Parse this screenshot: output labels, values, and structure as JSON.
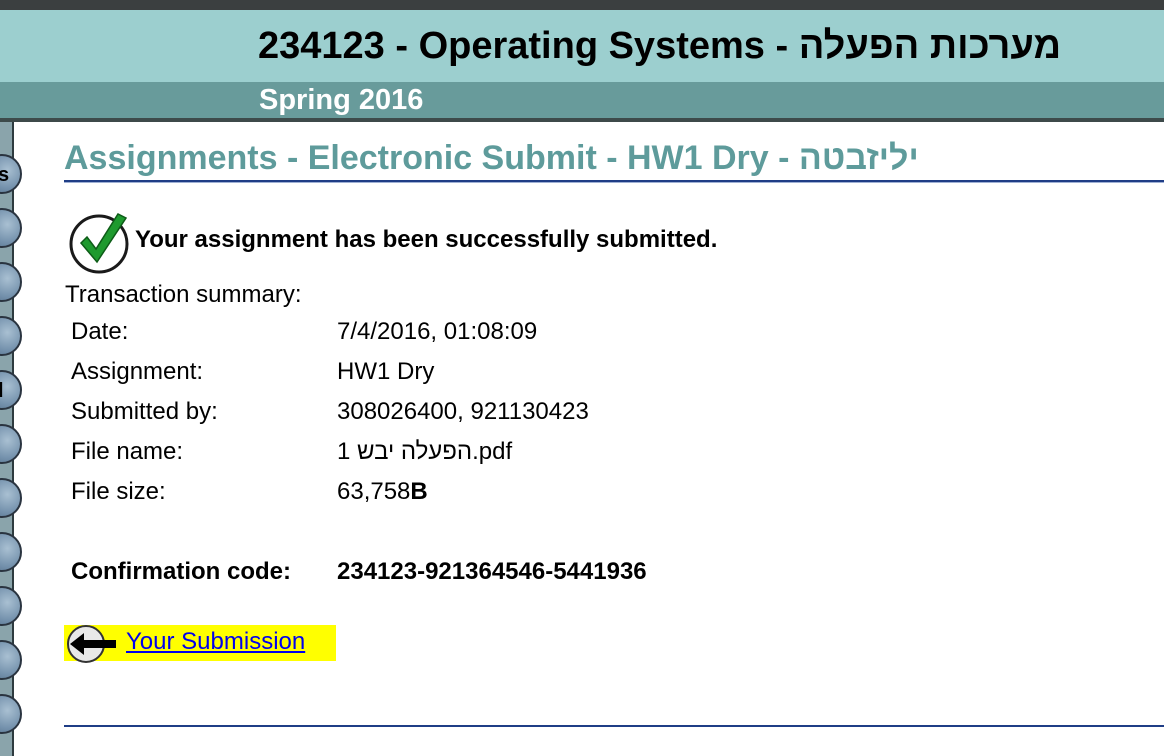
{
  "course": {
    "title": "234123 - Operating Systems - מערכות הפעלה",
    "semester": "Spring 2016"
  },
  "page": {
    "heading": "Assignments - Electronic Submit - HW1 Dry - יליזבטה"
  },
  "result": {
    "success_message": "Your assignment has been successfully submitted."
  },
  "summary": {
    "label": "Transaction summary:",
    "rows": [
      {
        "label": "Date:",
        "value": "7/4/2016, 01:08:09"
      },
      {
        "label": "Assignment:",
        "value": "HW1 Dry"
      },
      {
        "label": "Submitted by:",
        "value": "308026400, 921130423"
      },
      {
        "label": "File name:",
        "value": "הפעלה יבש 1.pdf"
      },
      {
        "label": "File size:",
        "value": "63,758",
        "unit": "B"
      }
    ],
    "confirmation": {
      "label": "Confirmation code:",
      "value": "234123-921364546-5441936"
    }
  },
  "nav": {
    "back_link": "Your Submission"
  },
  "sidebar": {
    "tab_letters": [
      "s",
      "l"
    ]
  },
  "colors": {
    "header_bg": "#9ccfcf",
    "subheader_bg": "#689b9b",
    "heading_text": "#5e9b9b",
    "rule": "#1f3d86",
    "link_highlight": "#ffff00",
    "link_text": "#0000ee",
    "check_green": "#1e9a2e"
  },
  "icons": [
    "check-icon",
    "back-arrow-icon"
  ]
}
